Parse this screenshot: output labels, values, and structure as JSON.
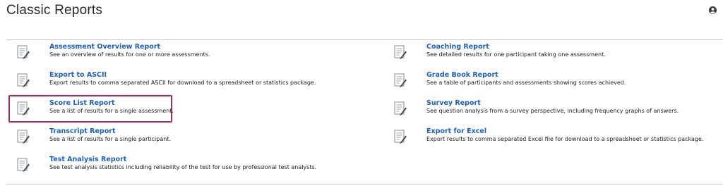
{
  "header": {
    "title": "Classic Reports",
    "user_icon": "user-circle-icon"
  },
  "reports_left": [
    {
      "title": "Assessment Overview Report",
      "description": "See an overview of results for one or more assessments."
    },
    {
      "title": "Export to ASCII",
      "description": "Export results to comma separated ASCII for download to a spreadsheet or statistics package."
    },
    {
      "title": "Score List Report",
      "description": "See a list of results for a single assessment.",
      "highlighted": true
    },
    {
      "title": "Transcript Report",
      "description": "See a list of results for a single participant."
    },
    {
      "title": "Test Analysis Report",
      "description": "See test analysis statistics including reliability of the test for use by professional test analysts."
    }
  ],
  "reports_right": [
    {
      "title": "Coaching Report",
      "description": "See detailed results for one participant taking one assessment."
    },
    {
      "title": "Grade Book Report",
      "description": "See a table of participants and assessments showing scores achieved."
    },
    {
      "title": "Survey Report",
      "description": "See question analysis from a survey perspective, including frequency graphs of answers."
    },
    {
      "title": "Export for Excel",
      "description": "Export results to comma separated Excel file for download to a spreadsheet or statistics package."
    }
  ],
  "colors": {
    "link": "#1f5fbf",
    "highlight_border": "#8b3a6b",
    "divider": "#c8c8c8"
  },
  "icons": {
    "report_icon": "document-pencil-icon"
  }
}
